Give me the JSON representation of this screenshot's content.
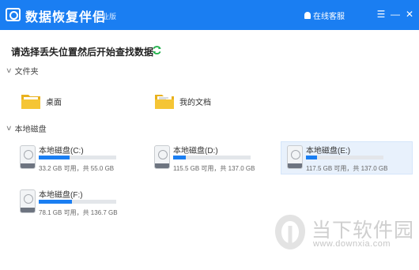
{
  "titlebar": {
    "app_title": "数据恢复伴侣",
    "edition": "专业版",
    "support": "在线客服",
    "menu_glyph": "☰",
    "minimize_glyph": "—",
    "close_glyph": "✕"
  },
  "prompt": "请选择丢失位置然后开始查找数据",
  "folders_section": {
    "title": "文件夹",
    "items": [
      {
        "label": "桌面",
        "icon": "desktop-folder-icon"
      },
      {
        "label": "我的文档",
        "icon": "documents-folder-icon"
      }
    ]
  },
  "drives_section": {
    "title": "本地磁盘",
    "drives": [
      {
        "name": "本地磁盘(C:)",
        "size_text": "33.2 GB 可用，共 55.0 GB",
        "used_fraction": 0.4,
        "selected": false
      },
      {
        "name": "本地磁盘(D:)",
        "size_text": "115.5 GB 可用，共 137.0 GB",
        "used_fraction": 0.16,
        "selected": false
      },
      {
        "name": "本地磁盘(E:)",
        "size_text": "117.5 GB 可用，共 137.0 GB",
        "used_fraction": 0.14,
        "selected": true
      },
      {
        "name": "本地磁盘(F:)",
        "size_text": "78.1 GB 可用，共 136.7 GB",
        "used_fraction": 0.43,
        "selected": false
      }
    ]
  },
  "watermark": {
    "text": "当下软件园",
    "url": "www.downxia.com"
  },
  "colors": {
    "accent": "#1a7ef2",
    "refresh": "#22b14c",
    "folder_yellow": "#f5c535"
  }
}
